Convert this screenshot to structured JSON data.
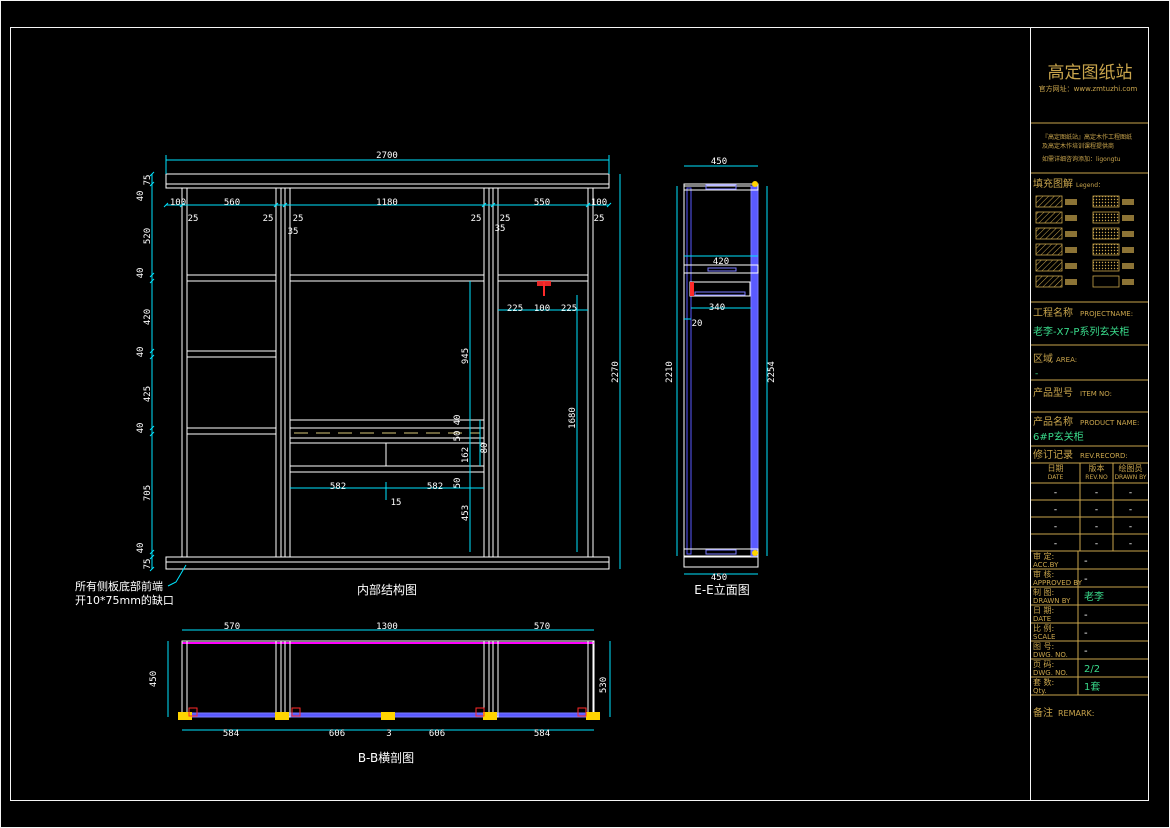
{
  "drawing": {
    "colors": {
      "background": "#000000",
      "frame": "#f5f5f5",
      "dimension": "#00e5ff",
      "titleblock": "#c8a44c",
      "structure": "#ffffff",
      "panel_face": "#7a7aff",
      "edge_band": "#ff00ff",
      "hardware": "#ffd400",
      "accent_red": "#ff2a2a",
      "value_green": "#39d98a"
    },
    "labels": {
      "internal_view": "内部结构图",
      "elevation_view": "E-E立面图",
      "section_view": "B-B横剖图",
      "note_line1": "所有侧板底部前端",
      "note_line2": "开10*75mm的缺口"
    },
    "front_dims": {
      "overall_width": "2700",
      "overall_height": "2270",
      "top_cells": [
        "100",
        "560",
        "1180",
        "550",
        "100"
      ],
      "top_thickness": [
        "25",
        "25",
        "25",
        "25",
        "25",
        "25"
      ],
      "top_small": [
        "35",
        "35"
      ],
      "left_vertical": [
        "75",
        "40",
        "520",
        "40",
        "420",
        "40",
        "425",
        "40",
        "705",
        "40",
        "75"
      ],
      "hang_rail": [
        "225",
        "100",
        "225"
      ],
      "inner_heights": [
        "945",
        "1680",
        "40",
        "50",
        "162",
        "80",
        "50",
        "453"
      ],
      "drawer_widths": [
        "582",
        "582"
      ],
      "center_gap": "15"
    },
    "side_dims": {
      "top_width": "450",
      "mid_width": "420",
      "mid_inner": "340",
      "mid_offset": "20",
      "bottom_width": "450",
      "inner_height": "2210",
      "overall_height": "2254"
    },
    "section_dims": {
      "top": [
        "570",
        "1300",
        "570"
      ],
      "bottom": [
        "584",
        "606",
        "3",
        "606",
        "584"
      ],
      "depth_left": "450",
      "depth_right": "530"
    },
    "titleblock": {
      "brand": "高定图纸站",
      "website": "官方网址：www.zmtuzhi.com",
      "promo_line1": "『高定图纸站』高定木作工程图纸",
      "promo_line2": "及高定木作培训课程提供商",
      "promo_line3": "如需详细咨询添加：ligongtu",
      "legend_title": "填充图解",
      "legend_sub": "Legend：",
      "project_label": "工程名称",
      "project_label_en": "PROJECTNAME:",
      "project_value": "老李-X7-P系列玄关柜",
      "area_label": "区域",
      "area_label_en": "AREA:",
      "area_value": "-",
      "item_label": "产品型号",
      "item_label_en": "ITEM NO:",
      "item_value": "",
      "product_label": "产品名称",
      "product_label_en": "PRODUCT NAME:",
      "product_value": "6#P玄关柜",
      "rev_label": "修订记录",
      "rev_label_en": "REV.RECORD:",
      "rev_cols": [
        "日期 DATE",
        "版本 REV.NO",
        "绘图员 DRAWN BY"
      ],
      "rev_rows": [
        [
          "-",
          "-",
          "-"
        ],
        [
          "-",
          "-",
          "-"
        ],
        [
          "-",
          "-",
          "-"
        ],
        [
          "-",
          "-",
          "-"
        ]
      ],
      "meta": [
        {
          "cn": "审 定:",
          "en": "ACC.BY",
          "value": "-"
        },
        {
          "cn": "审 核:",
          "en": "APPROVED BY",
          "value": "-"
        },
        {
          "cn": "制 图:",
          "en": "DRAWN BY",
          "value": "老李"
        },
        {
          "cn": "日 期:",
          "en": "DATE",
          "value": "-"
        },
        {
          "cn": "比 例:",
          "en": "SCALE",
          "value": "-"
        },
        {
          "cn": "图 号:",
          "en": "DWG. NO.",
          "value": "-"
        },
        {
          "cn": "页 码:",
          "en": "DWG. NO.",
          "value": "2/2"
        },
        {
          "cn": "套 数:",
          "en": "Qty.",
          "value": "1套"
        }
      ],
      "remark_label": "备注",
      "remark_label_en": "REMARK:"
    }
  }
}
